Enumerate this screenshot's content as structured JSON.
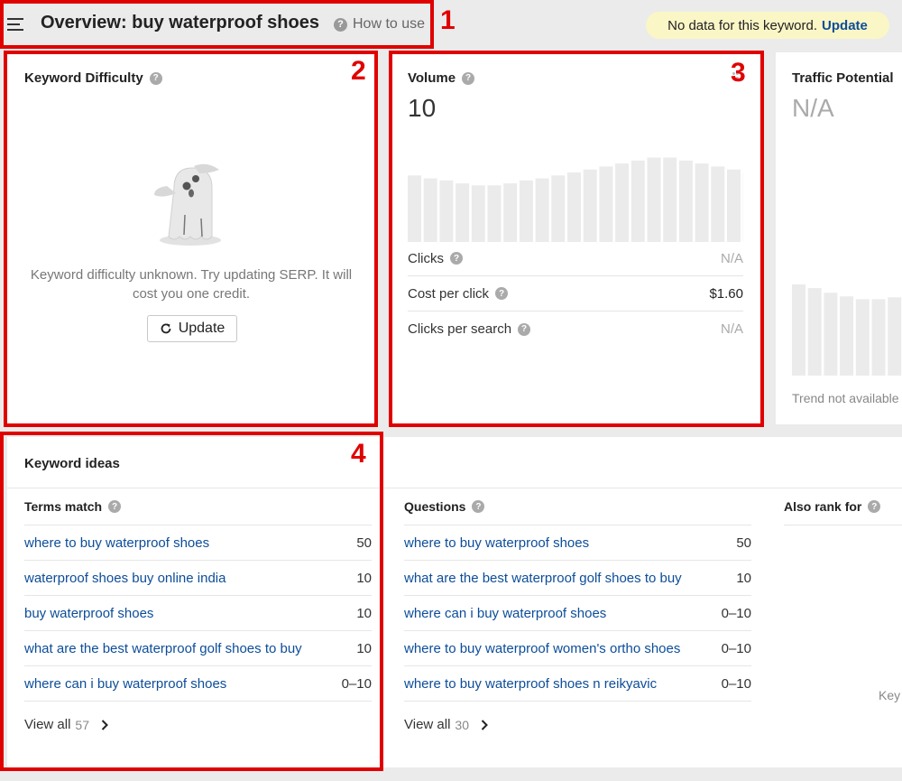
{
  "header": {
    "title": "Overview: buy waterproof shoes",
    "how_to_use": "How to use",
    "help_mark": "?",
    "no_data_text": "No data for this keyword.",
    "update_link": "Update"
  },
  "keyword_difficulty": {
    "title": "Keyword Difficulty",
    "message": "Keyword difficulty unknown. Try updating SERP. It will cost you one credit.",
    "update_button": "Update"
  },
  "volume": {
    "title": "Volume",
    "value": "10",
    "trend_bars": [
      0.67,
      0.64,
      0.62,
      0.59,
      0.57,
      0.57,
      0.59,
      0.62,
      0.64,
      0.67,
      0.7,
      0.73,
      0.76,
      0.79,
      0.82,
      0.85,
      0.85,
      0.82,
      0.79,
      0.76,
      0.73,
      0.69
    ],
    "metrics": [
      {
        "label": "Clicks",
        "value": "N/A"
      },
      {
        "label": "Cost per click",
        "value": "$1.60"
      },
      {
        "label": "Clicks per search",
        "value": "N/A"
      }
    ]
  },
  "traffic_potential": {
    "title": "Traffic Potential",
    "value": "N/A",
    "trend_bars": [
      0.99,
      0.95,
      0.9,
      0.86,
      0.83,
      0.83,
      0.85
    ],
    "trend_note": "Trend not available"
  },
  "keyword_ideas": {
    "title": "Keyword ideas",
    "columns": [
      {
        "title": "Terms match",
        "rows": [
          {
            "keyword": "where to buy waterproof shoes",
            "volume": "50"
          },
          {
            "keyword": "waterproof shoes buy online india",
            "volume": "10"
          },
          {
            "keyword": "buy waterproof shoes",
            "volume": "10"
          },
          {
            "keyword": "what are the best waterproof golf shoes to buy",
            "volume": "10"
          },
          {
            "keyword": "where can i buy waterproof shoes",
            "volume": "0–10"
          }
        ],
        "view_all": "View all",
        "count": "57"
      },
      {
        "title": "Questions",
        "rows": [
          {
            "keyword": "where to buy waterproof shoes",
            "volume": "50"
          },
          {
            "keyword": "what are the best waterproof golf shoes to buy",
            "volume": "10"
          },
          {
            "keyword": "where can i buy waterproof shoes",
            "volume": "0–10"
          },
          {
            "keyword": "where to buy waterproof women's ortho shoes",
            "volume": "0–10"
          },
          {
            "keyword": "where to buy waterproof shoes n reikyavic",
            "volume": "0–10"
          }
        ],
        "view_all": "View all",
        "count": "30"
      },
      {
        "title": "Also rank for",
        "partial_text": "Key"
      }
    ]
  },
  "annotations": [
    "1",
    "2",
    "3",
    "4"
  ],
  "colors": {
    "link": "#0c4d99",
    "annotation_red": "#e00000",
    "bar_gray": "#ebebeb",
    "nodata_bg": "#fbf6c6"
  },
  "icons": [
    "hamburger-icon",
    "help-icon",
    "ghost-illustration",
    "refresh-icon",
    "chevron-right-icon",
    "menu-dots-icon"
  ]
}
